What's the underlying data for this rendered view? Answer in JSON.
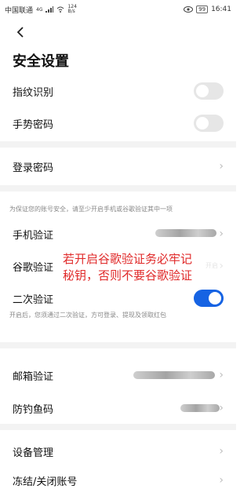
{
  "status_bar": {
    "carrier": "中国联通",
    "signal": "4G",
    "net_speed_top": "124",
    "net_speed_bottom": "B/s",
    "battery": "99",
    "time": "16:41"
  },
  "header": {
    "back_icon": "chevron-left-icon",
    "title": "安全设置"
  },
  "settings": {
    "fingerprint": {
      "label": "指纹识别",
      "enabled": false
    },
    "gesture": {
      "label": "手势密码",
      "enabled": false
    },
    "login_password": {
      "label": "登录密码"
    }
  },
  "verification": {
    "hint": "为保证您的账号安全，请至少开启手机或谷歌验证其中一项",
    "phone": {
      "label": "手机验证"
    },
    "google": {
      "label": "谷歌验证"
    },
    "two_step": {
      "label": "二次验证",
      "enabled": true
    },
    "two_step_hint": "开启后，您须通过二次验证，方可登录、提现及领取红包"
  },
  "security_extra": {
    "email": {
      "label": "邮箱验证"
    },
    "anti_phishing": {
      "label": "防钓鱼码"
    }
  },
  "account": {
    "devices": {
      "label": "设备管理"
    },
    "freeze": {
      "label": "冻结/关闭账号"
    }
  },
  "annotation": {
    "line1": "若开启谷歌验证务必牢记",
    "line2": "秘钥，否则不要谷歌验证"
  },
  "google_right_fragment": "开启",
  "colors": {
    "accent": "#1663e3",
    "annotation": "#e02a2a"
  }
}
